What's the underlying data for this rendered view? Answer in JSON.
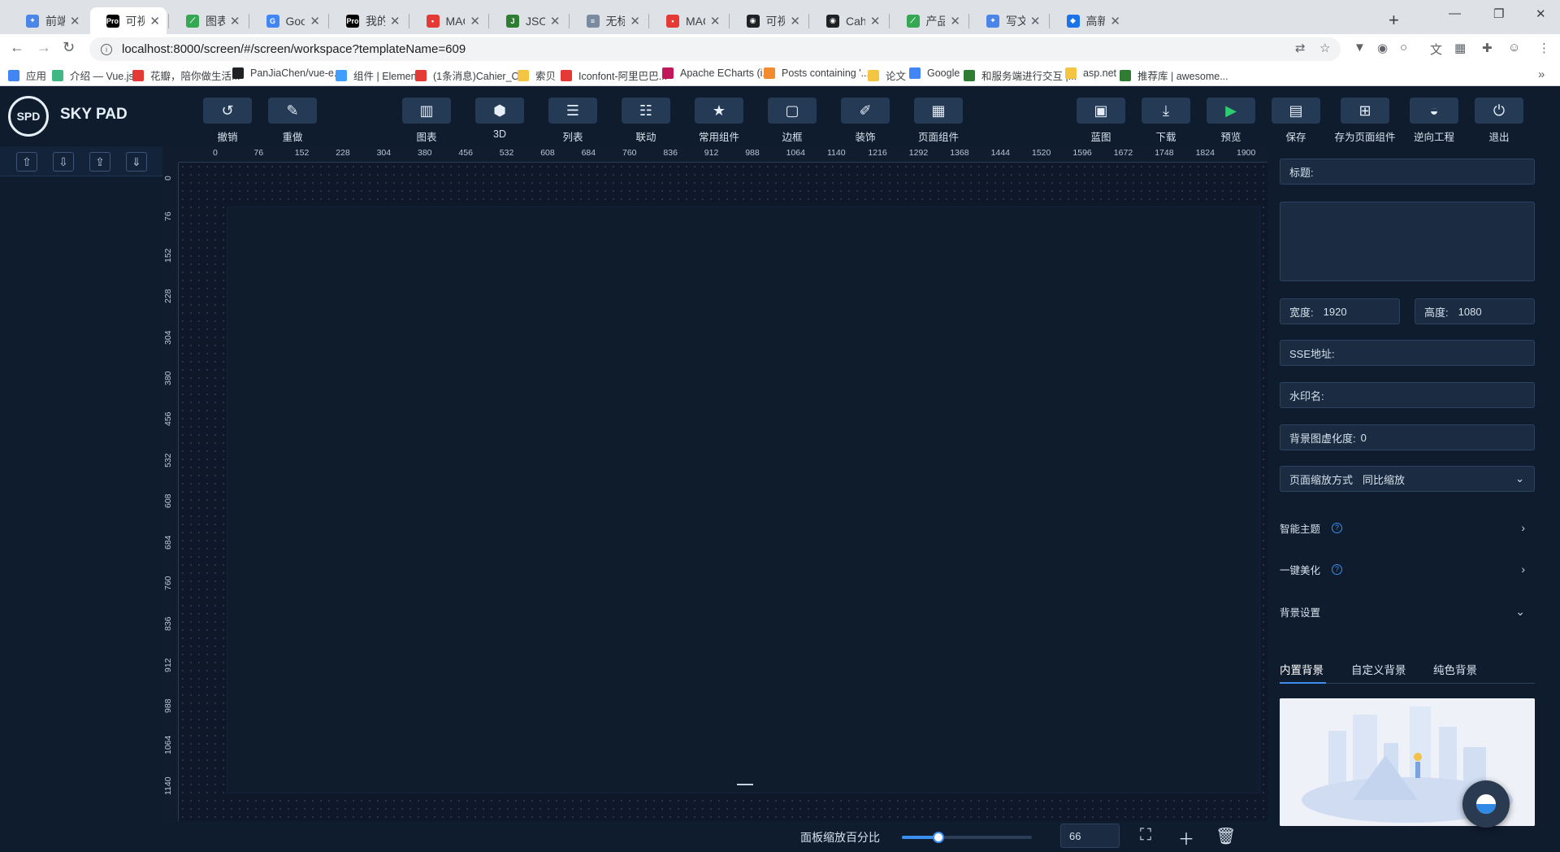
{
  "browser": {
    "tabs": [
      {
        "title": "前端-掘金",
        "color": "#4a86e8",
        "glyph": "✦"
      },
      {
        "title": "可视化平台",
        "color": "#000000",
        "glyph": "Pro"
      },
      {
        "title": "图表组件",
        "color": "#34a853",
        "glyph": "⟋"
      },
      {
        "title": "Google 翻",
        "color": "#4285f4",
        "glyph": "G"
      },
      {
        "title": "我的工作",
        "color": "#000000",
        "glyph": "Pro"
      },
      {
        "title": "MAGIC 智",
        "color": "#e53935",
        "glyph": "•"
      },
      {
        "title": "JSON在线",
        "color": "#2e7d32",
        "glyph": "J"
      },
      {
        "title": "无标题 - 语",
        "color": "#7a8ba0",
        "glyph": "≡"
      },
      {
        "title": "MAGIC 板",
        "color": "#e53935",
        "glyph": "•"
      },
      {
        "title": "可视化平台",
        "color": "#202124",
        "glyph": "◉"
      },
      {
        "title": "CahierX/c",
        "color": "#202124",
        "glyph": "◉"
      },
      {
        "title": "产品手册",
        "color": "#34a853",
        "glyph": "⟋"
      },
      {
        "title": "写文章 - S",
        "color": "#4a86e8",
        "glyph": "✦"
      },
      {
        "title": "高新融合",
        "color": "#1a73e8",
        "glyph": "◆"
      }
    ],
    "url": "localhost:8000/screen/#/screen/workspace?templateName=609",
    "bookmarks": [
      {
        "label": "应用",
        "color": "#4285f4"
      },
      {
        "label": "介绍 — Vue.js",
        "color": "#41b883"
      },
      {
        "label": "花瓣，陪你做生活...",
        "color": "#e53935"
      },
      {
        "label": "PanJiaChen/vue-e...",
        "color": "#202124"
      },
      {
        "label": "组件 | Element",
        "color": "#409eff"
      },
      {
        "label": "(1条消息)Cahier_C...",
        "color": "#e53935"
      },
      {
        "label": "索贝",
        "color": "#f4c542"
      },
      {
        "label": "Iconfont-阿里巴巴...",
        "color": "#e53935"
      },
      {
        "label": "Apache ECharts (i...",
        "color": "#c2185b"
      },
      {
        "label": "Posts containing '...",
        "color": "#f28b30"
      },
      {
        "label": "论文",
        "color": "#f4c542"
      },
      {
        "label": "Google",
        "color": "#4285f4"
      },
      {
        "label": "和服务端进行交互 |...",
        "color": "#2e7d32"
      },
      {
        "label": "asp.net",
        "color": "#f4c542"
      },
      {
        "label": "推荐库 | awesome...",
        "color": "#2e7d32"
      }
    ]
  },
  "app": {
    "logo_text": "SPD",
    "brand": "SKY PAD",
    "tools_left": [
      {
        "label": "撤销",
        "icon": "undo-icon",
        "glyph": "↺"
      },
      {
        "label": "重做",
        "icon": "eraser-icon",
        "glyph": "✎"
      }
    ],
    "tools_center": [
      {
        "label": "图表",
        "icon": "bar-chart-icon",
        "glyph": "▥"
      },
      {
        "label": "3D",
        "icon": "cube-icon",
        "glyph": "⬢"
      },
      {
        "label": "列表",
        "icon": "list-icon",
        "glyph": "☰"
      },
      {
        "label": "联动",
        "icon": "layers-icon",
        "glyph": "☷"
      },
      {
        "label": "常用组件",
        "icon": "star-icon",
        "glyph": "★"
      },
      {
        "label": "边框",
        "icon": "border-icon",
        "glyph": "▢"
      },
      {
        "label": "装饰",
        "icon": "brush-icon",
        "glyph": "✐"
      },
      {
        "label": "页面组件",
        "icon": "grid-icon",
        "glyph": "▦"
      }
    ],
    "tools_right": [
      {
        "label": "蓝图",
        "icon": "blueprint-icon",
        "glyph": "▣",
        "color": "#e6eef7"
      },
      {
        "label": "下载",
        "icon": "download-icon",
        "glyph": "⤓",
        "color": "#e6eef7"
      },
      {
        "label": "预览",
        "icon": "play-icon",
        "glyph": "▶",
        "color": "#2ecc71"
      },
      {
        "label": "保存",
        "icon": "save-icon",
        "glyph": "▤",
        "color": "#e6eef7"
      },
      {
        "label": "存为页面组件",
        "icon": "save-component-icon",
        "glyph": "⊞",
        "color": "#e6eef7"
      },
      {
        "label": "逆向工程",
        "icon": "reverse-icon",
        "glyph": "◒",
        "color": "#e6eef7"
      },
      {
        "label": "退出",
        "icon": "power-icon",
        "glyph": "⏻",
        "color": "#e6eef7"
      }
    ],
    "layer_buttons": [
      "⇧",
      "⇩",
      "⇪",
      "⇓"
    ]
  },
  "ruler": {
    "top": [
      "0",
      "76",
      "152",
      "228",
      "304",
      "380",
      "456",
      "532",
      "608",
      "684",
      "760",
      "836",
      "912",
      "988",
      "1064",
      "1140",
      "1216",
      "1292",
      "1368",
      "1444",
      "1520",
      "1596",
      "1672",
      "1748",
      "1824",
      "1900"
    ],
    "left": [
      "0",
      "76",
      "152",
      "228",
      "304",
      "380",
      "456",
      "532",
      "608",
      "684",
      "760",
      "836",
      "912",
      "988",
      "1064",
      "1140"
    ]
  },
  "bottom": {
    "zoom_label": "面板缩放百分比",
    "zoom_value": "66",
    "zoom_fraction": 0.28
  },
  "props": {
    "title_label": "标题:",
    "width_label": "宽度:",
    "width_value": "1920",
    "height_label": "高度:",
    "height_value": "1080",
    "sse_label": "SSE地址:",
    "watermark_label": "水印名:",
    "blur_label": "背景图虚化度:",
    "blur_value": "0",
    "scale_label": "页面缩放方式",
    "scale_value": "同比缩放",
    "smart_theme": "智能主题",
    "beautify": "一键美化",
    "bg_settings": "背景设置",
    "bg_tabs": [
      "内置背景",
      "自定义背景",
      "纯色背景"
    ]
  }
}
